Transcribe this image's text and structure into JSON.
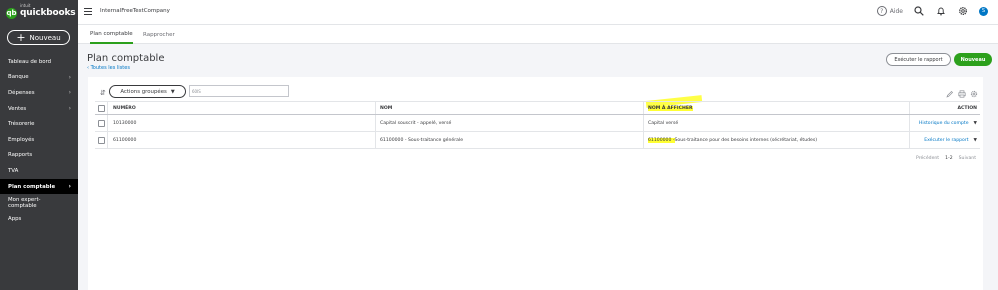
{
  "app": {
    "logo_intuit": "intuit",
    "logo_text": "quickbooks",
    "company": "InternalFreeTestCompany"
  },
  "sidebar": {
    "new_button": "Nouveau",
    "items": [
      {
        "label": "Tableau de bord",
        "chevron": false
      },
      {
        "label": "Banque",
        "chevron": true
      },
      {
        "label": "Dépenses",
        "chevron": true
      },
      {
        "label": "Ventes",
        "chevron": true
      },
      {
        "label": "Trésorerie",
        "chevron": false
      },
      {
        "label": "Employés",
        "chevron": false
      },
      {
        "label": "Rapports",
        "chevron": false
      },
      {
        "label": "TVA",
        "chevron": false
      },
      {
        "label": "Plan comptable",
        "chevron": true,
        "active": true
      },
      {
        "label": "Mon expert-comptable",
        "chevron": false
      },
      {
        "label": "Apps",
        "chevron": false
      }
    ]
  },
  "topbar": {
    "help_label": "Aide",
    "avatar_letter": "S"
  },
  "tabs": [
    {
      "label": "Plan comptable",
      "active": true
    },
    {
      "label": "Rapprocher",
      "active": false
    }
  ],
  "page": {
    "title": "Plan comptable",
    "back_link": "Toutes les listes",
    "run_report": "Exécuter le rapport",
    "new": "Nouveau"
  },
  "toolbar": {
    "batch_actions": "Actions groupées",
    "search_value": "60IS"
  },
  "table": {
    "headers": {
      "number": "NUMÉRO",
      "name": "NOM",
      "display_name": "NOM À AFFICHER",
      "action": "ACTION"
    },
    "rows": [
      {
        "number": "10130000",
        "name": "Capital souscrit - appelé, versé",
        "display_prefix": "",
        "display_rest": "Capital versé",
        "action": "Historique du compte"
      },
      {
        "number": "61100000",
        "name": "61100000 - Sous-traitance générale",
        "display_prefix": "61100000 -",
        "display_rest": " Sous-traitance pour des besoins internes (sécrétariat, études)",
        "action": "Exécuter le rapport"
      }
    ]
  },
  "pager": {
    "previous": "Précédent",
    "range": "1-2",
    "next": "Suivant"
  },
  "colors": {
    "brand_green": "#2ca01c",
    "link_blue": "#0077c5",
    "sidebar_bg": "#393a3d",
    "highlight": "#ffff33"
  }
}
